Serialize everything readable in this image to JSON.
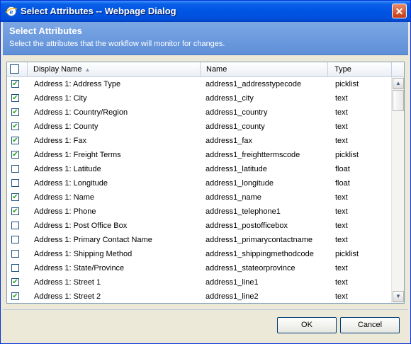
{
  "window": {
    "title": "Select Attributes -- Webpage Dialog",
    "close_glyph": "✕"
  },
  "header": {
    "title": "Select Attributes",
    "description": "Select the attributes that the workflow will monitor for changes."
  },
  "grid": {
    "columns": {
      "display_name": "Display Name",
      "name": "Name",
      "type": "Type"
    },
    "sort_indicator": "▲",
    "rows": [
      {
        "checked": true,
        "display": "Address 1: Address Type",
        "name": "address1_addresstypecode",
        "type": "picklist"
      },
      {
        "checked": true,
        "display": "Address 1: City",
        "name": "address1_city",
        "type": "text"
      },
      {
        "checked": true,
        "display": "Address 1: Country/Region",
        "name": "address1_country",
        "type": "text"
      },
      {
        "checked": true,
        "display": "Address 1: County",
        "name": "address1_county",
        "type": "text"
      },
      {
        "checked": true,
        "display": "Address 1: Fax",
        "name": "address1_fax",
        "type": "text"
      },
      {
        "checked": true,
        "display": "Address 1: Freight Terms",
        "name": "address1_freighttermscode",
        "type": "picklist"
      },
      {
        "checked": false,
        "display": "Address 1: Latitude",
        "name": "address1_latitude",
        "type": "float"
      },
      {
        "checked": false,
        "display": "Address 1: Longitude",
        "name": "address1_longitude",
        "type": "float"
      },
      {
        "checked": true,
        "display": "Address 1: Name",
        "name": "address1_name",
        "type": "text"
      },
      {
        "checked": true,
        "display": "Address 1: Phone",
        "name": "address1_telephone1",
        "type": "text"
      },
      {
        "checked": false,
        "display": "Address 1: Post Office Box",
        "name": "address1_postofficebox",
        "type": "text"
      },
      {
        "checked": false,
        "display": "Address 1: Primary Contact Name",
        "name": "address1_primarycontactname",
        "type": "text"
      },
      {
        "checked": false,
        "display": "Address 1: Shipping Method",
        "name": "address1_shippingmethodcode",
        "type": "picklist"
      },
      {
        "checked": false,
        "display": "Address 1: State/Province",
        "name": "address1_stateorprovince",
        "type": "text"
      },
      {
        "checked": true,
        "display": "Address 1: Street 1",
        "name": "address1_line1",
        "type": "text"
      },
      {
        "checked": true,
        "display": "Address 1: Street 2",
        "name": "address1_line2",
        "type": "text"
      }
    ]
  },
  "scrollbar": {
    "up_glyph": "▲",
    "down_glyph": "▼"
  },
  "buttons": {
    "ok": "OK",
    "cancel": "Cancel"
  },
  "colors": {
    "check_mark": "#21a121",
    "title_bar": "#0054e3",
    "header_band": "#6b98dc"
  },
  "icons": {
    "title": "ie-globe-icon",
    "checkmark": "✔"
  }
}
